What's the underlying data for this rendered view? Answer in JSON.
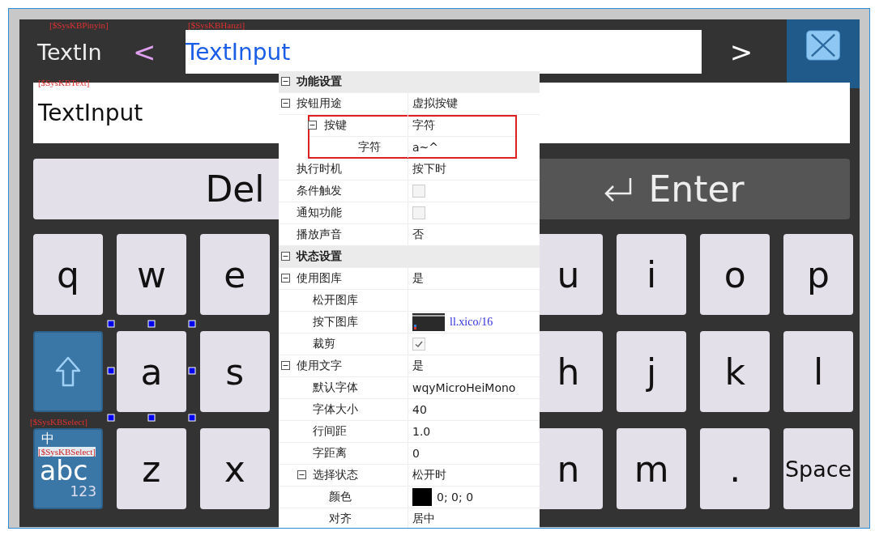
{
  "header": {
    "pinyin": {
      "tag": "[$SysKBPinyin]",
      "text": "TextIn"
    },
    "prev": "<",
    "candidates": {
      "tag": "[$SysKBHanzi]",
      "text": "TextInput"
    },
    "next": ">"
  },
  "text_field": {
    "tag": "[$SysKBText]",
    "value": "TextInput"
  },
  "wide_keys": [
    {
      "kind": "del",
      "label": "Del"
    },
    {
      "kind": "enter",
      "label": "Enter"
    }
  ],
  "rows": [
    {
      "left": [
        {
          "kind": "char",
          "label": "q",
          "selected": false
        },
        {
          "kind": "char",
          "label": "w",
          "selected": false
        },
        {
          "kind": "char",
          "label": "e",
          "selected": false
        }
      ],
      "right": [
        {
          "kind": "char",
          "label": "u",
          "selected": false
        },
        {
          "kind": "char",
          "label": "i",
          "selected": false
        },
        {
          "kind": "char",
          "label": "o",
          "selected": false
        },
        {
          "kind": "char",
          "label": "p",
          "selected": false
        }
      ]
    },
    {
      "left": [
        {
          "kind": "shift",
          "selected": false
        },
        {
          "kind": "char",
          "label": "a",
          "selected": true
        },
        {
          "kind": "char",
          "label": "s",
          "selected": false
        }
      ],
      "right": [
        {
          "kind": "char",
          "label": "h",
          "selected": false
        },
        {
          "kind": "char",
          "label": "j",
          "selected": false
        },
        {
          "kind": "char",
          "label": "k",
          "selected": false
        },
        {
          "kind": "char",
          "label": "l",
          "selected": false
        }
      ]
    },
    {
      "left": [
        {
          "kind": "mode",
          "top_label": "中",
          "label": "abc",
          "sub_label": "123",
          "tags": [
            "[$SysKBSelect]",
            "[$SysKBSelect]"
          ],
          "selected": false
        },
        {
          "kind": "char",
          "label": "z",
          "selected": false
        },
        {
          "kind": "char",
          "label": "x",
          "selected": false
        }
      ],
      "right": [
        {
          "kind": "char",
          "label": "n",
          "selected": false
        },
        {
          "kind": "char",
          "label": "m",
          "selected": false
        },
        {
          "kind": "char",
          "label": ".",
          "selected": false
        },
        {
          "kind": "char",
          "label": "Space",
          "selected": false
        }
      ]
    }
  ],
  "properties": [
    {
      "kind": "section",
      "label": "功能设置",
      "expanded": true,
      "highlighted": false,
      "children": [
        {
          "kind": "text",
          "label": "按钮用途",
          "value": "虚拟按键",
          "expanded": true,
          "highlighted": false,
          "children": [
            {
              "kind": "text",
              "label": "按键",
              "value": "字符",
              "expanded": true,
              "highlighted": true,
              "children": [
                {
                  "kind": "text",
                  "label": "字符",
                  "value": "a~^",
                  "highlighted": false
                }
              ]
            }
          ]
        },
        {
          "kind": "text",
          "label": "执行时机",
          "value": "按下时",
          "highlighted": false
        },
        {
          "kind": "checkbox",
          "label": "条件触发",
          "checked": false,
          "highlighted": false
        },
        {
          "kind": "checkbox",
          "label": "通知功能",
          "checked": false,
          "highlighted": false
        },
        {
          "kind": "text",
          "label": "播放声音",
          "value": "否",
          "highlighted": false
        }
      ]
    },
    {
      "kind": "section",
      "label": "状态设置",
      "expanded": true,
      "highlighted": false,
      "children": [
        {
          "kind": "text",
          "label": "使用图库",
          "value": "是",
          "expanded": true,
          "highlighted": false,
          "children": [
            {
              "kind": "text",
              "label": "松开图库",
              "highlighted": false
            },
            {
              "kind": "image",
              "label": "按下图库",
              "value": "ll.xico/16",
              "highlighted": false
            },
            {
              "kind": "checkbox",
              "label": "裁剪",
              "checked": true,
              "highlighted": false
            }
          ]
        },
        {
          "kind": "text",
          "label": "使用文字",
          "value": "是",
          "expanded": true,
          "highlighted": false,
          "children": [
            {
              "kind": "text",
              "label": "默认字体",
              "value": "wqyMicroHeiMono",
              "highlighted": false
            },
            {
              "kind": "text",
              "label": "字体大小",
              "value": "40",
              "highlighted": false
            },
            {
              "kind": "text",
              "label": "行间距",
              "value": "1.0",
              "highlighted": false
            },
            {
              "kind": "text",
              "label": "字距离",
              "value": "0",
              "highlighted": false
            },
            {
              "kind": "text",
              "label": "选择状态",
              "value": "松开时",
              "expanded": true,
              "highlighted": false,
              "children": [
                {
                  "kind": "color",
                  "label": "颜色",
                  "color": "#000000",
                  "value": "0; 0; 0",
                  "highlighted": false
                },
                {
                  "kind": "text",
                  "label": "对齐",
                  "value": "居中",
                  "highlighted": false
                }
              ]
            }
          ]
        }
      ]
    }
  ]
}
